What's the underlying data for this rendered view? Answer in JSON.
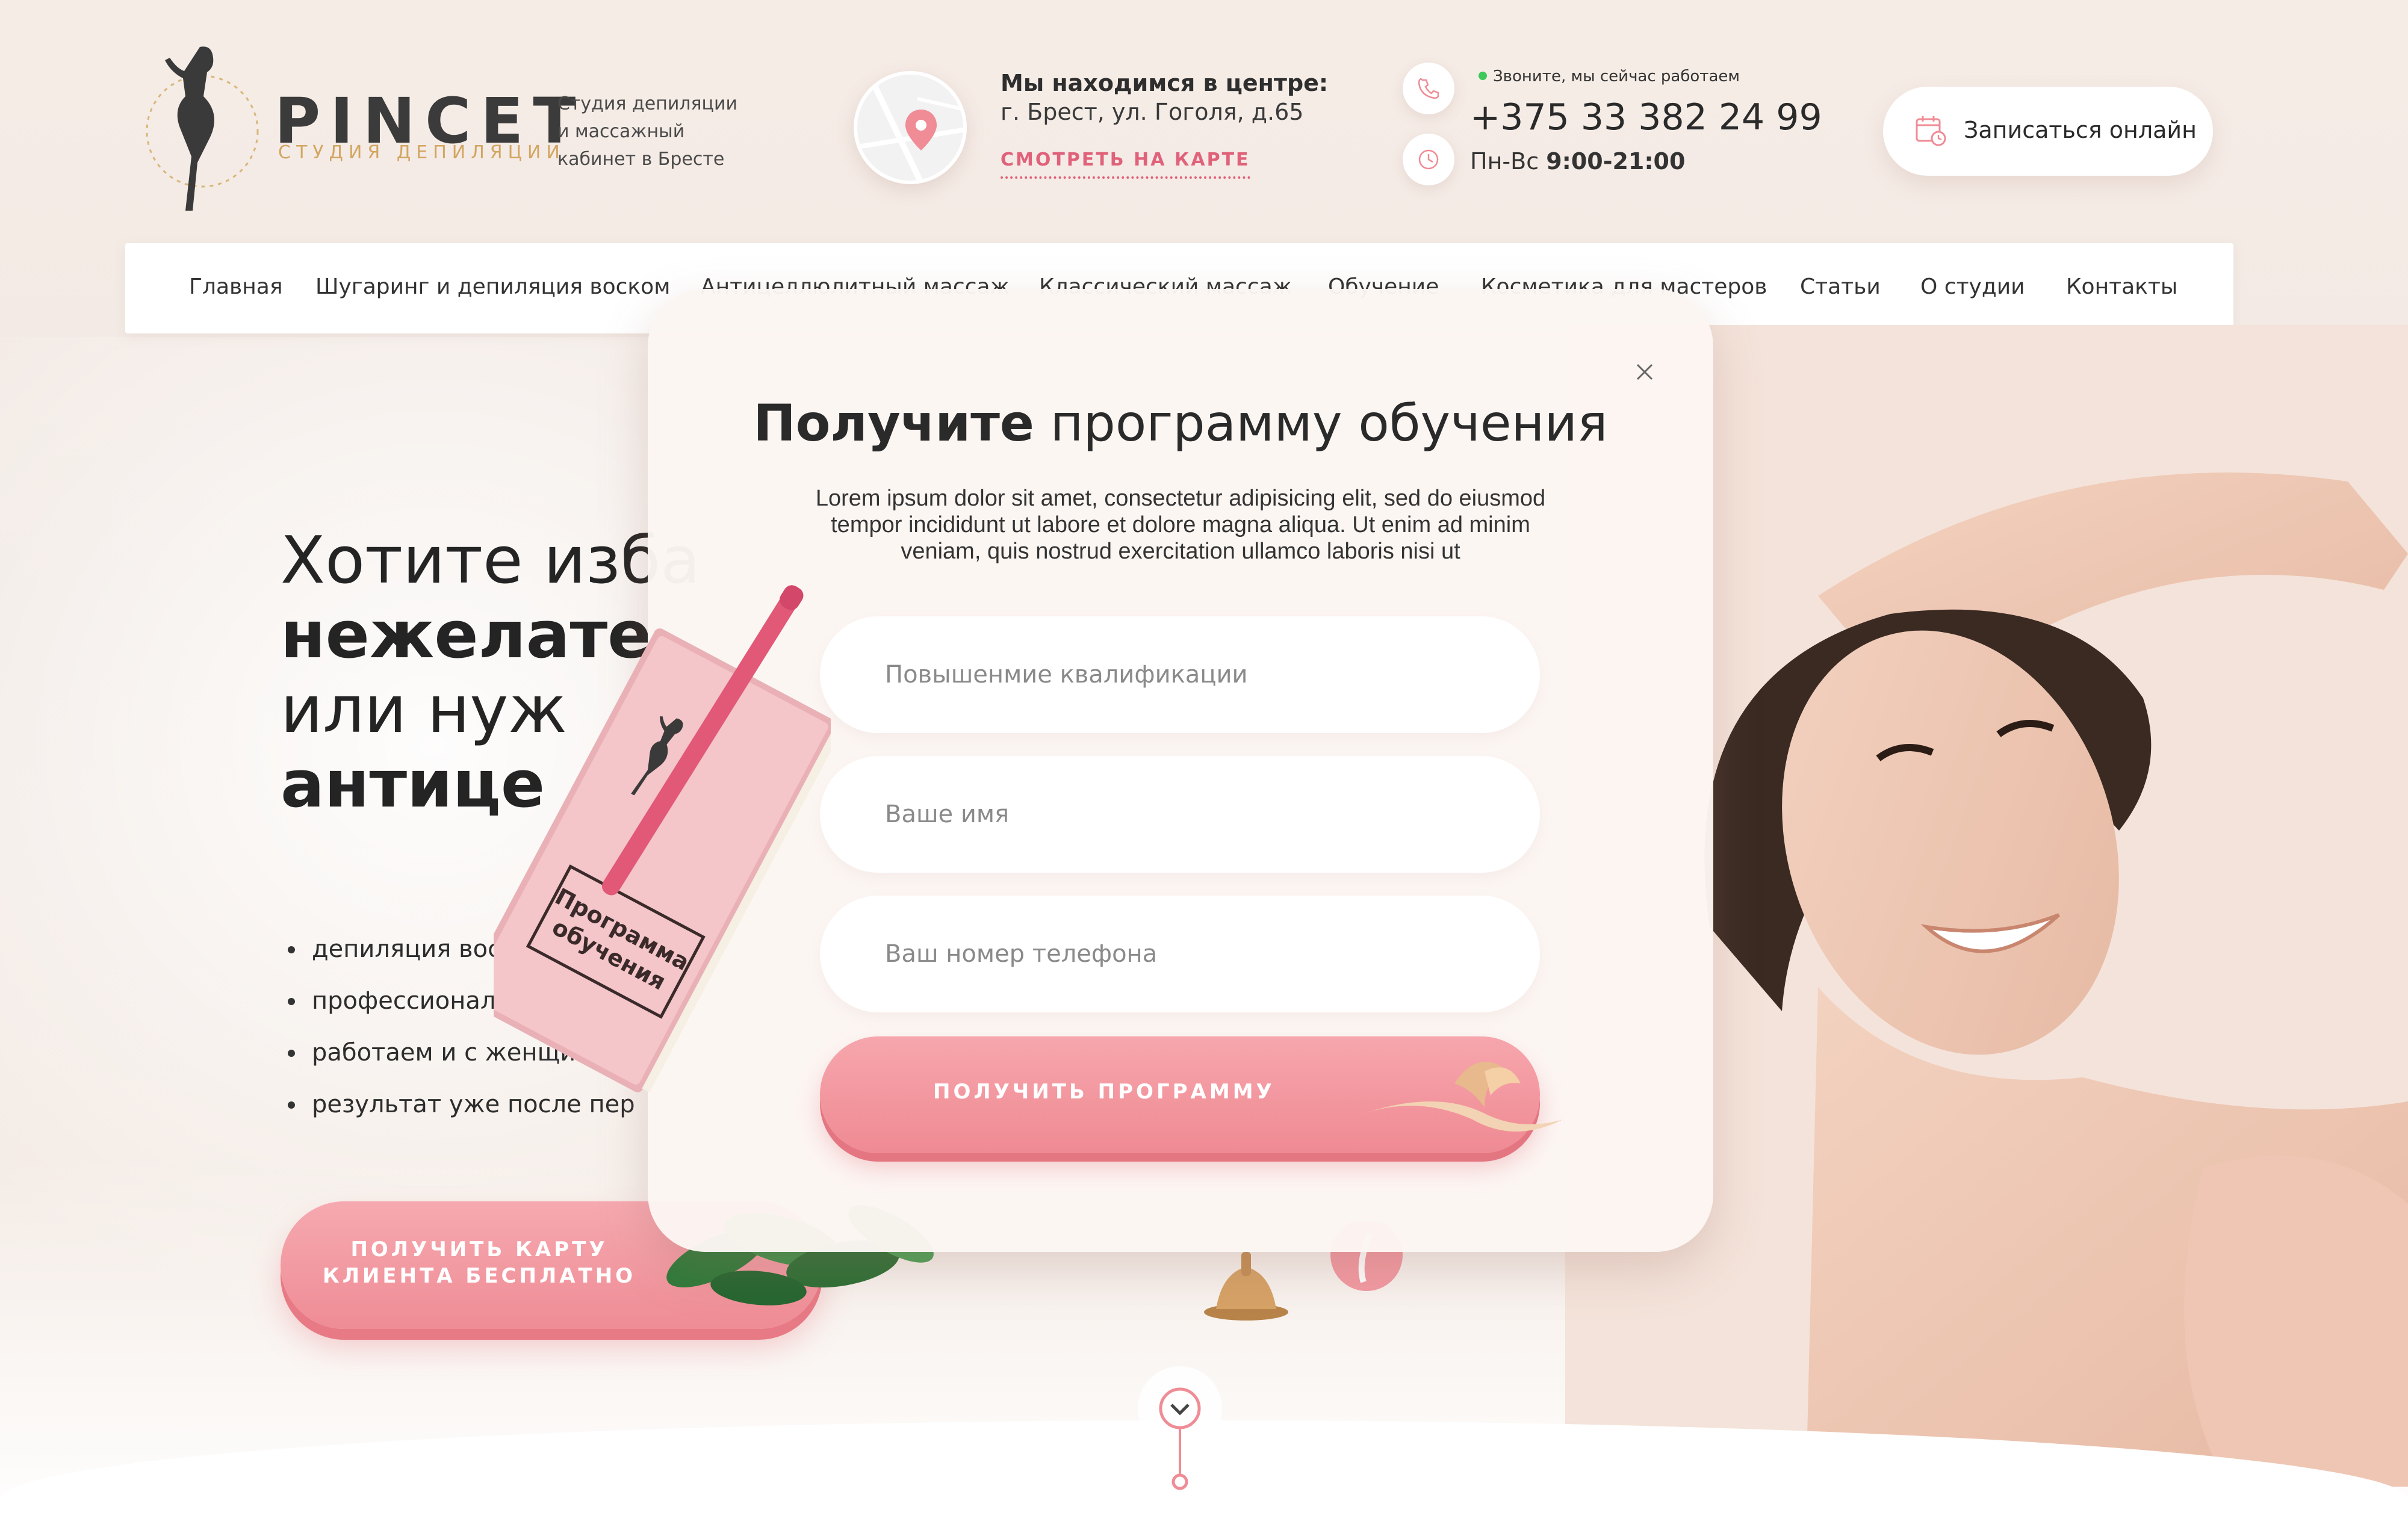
{
  "logo": {
    "word": "PINCET",
    "sub": "СТУДИЯ ДЕПИЛЯЦИИ",
    "tagline": [
      "Студия депиляции",
      "и массажный",
      "кабинет в Бресте"
    ]
  },
  "location": {
    "title": "Мы находимся в центре:",
    "address": "г. Брест, ул. Гоголя, д.65",
    "map_link": "СМОТРЕТЬ НА КАРТЕ"
  },
  "contact": {
    "status": "Звоните, мы сейчас работаем",
    "phone": "+375 33 382 24 99",
    "hours_days": "Пн-Вс",
    "hours_time": "9:00-21:00"
  },
  "header": {
    "book_label": "Записаться онлайн"
  },
  "nav": {
    "items": [
      "Главная",
      "Шугаринг и депиляция воском",
      "Антицеллюлитный массаж",
      "Классический массаж",
      "Обучение",
      "Косметика для мастеров",
      "Статьи",
      "О студии",
      "Контакты"
    ]
  },
  "hero": {
    "line1": "Хотите изба",
    "line2": "нежелате",
    "line3": "или нуж",
    "line4": "антице",
    "features": [
      "депиляция воском и",
      "профессиональные се",
      "работаем и с женщинам",
      "результат уже после пер"
    ],
    "cta_line1": "ПОЛУЧИТЬ КАРТУ",
    "cta_line2": "КЛИЕНТА БЕСПЛАТНО"
  },
  "modal": {
    "title_bold": "Получите",
    "title_rest": "программу обучения",
    "description": "Lorem ipsum dolor sit amet, consectetur adipisicing elit, sed do eiusmod tempor incididunt ut labore et dolore magna aliqua. Ut enim ad minim veniam, quis nostrud exercitation ullamco laboris nisi ut",
    "field_course_placeholder": "Повышенмие квалификации",
    "field_name_placeholder": "Ваше имя",
    "field_phone_placeholder": "Ваш номер телефона",
    "submit_label": "ПОЛУЧИТЬ ПРОГРАММУ"
  },
  "notebook": {
    "cover_text_line1": "Программа",
    "cover_text_line2": "обучения"
  },
  "icons": {
    "map_pin": "map-pin-icon",
    "phone": "phone-icon",
    "clock": "clock-icon",
    "calendar": "calendar-icon",
    "close": "close-icon",
    "scroll_down": "chevron-down-icon"
  },
  "colors": {
    "accent_pink": "#ef8c95",
    "link_pink": "#e0627a",
    "gold": "#d2a661",
    "status_green": "#3cc85a"
  }
}
